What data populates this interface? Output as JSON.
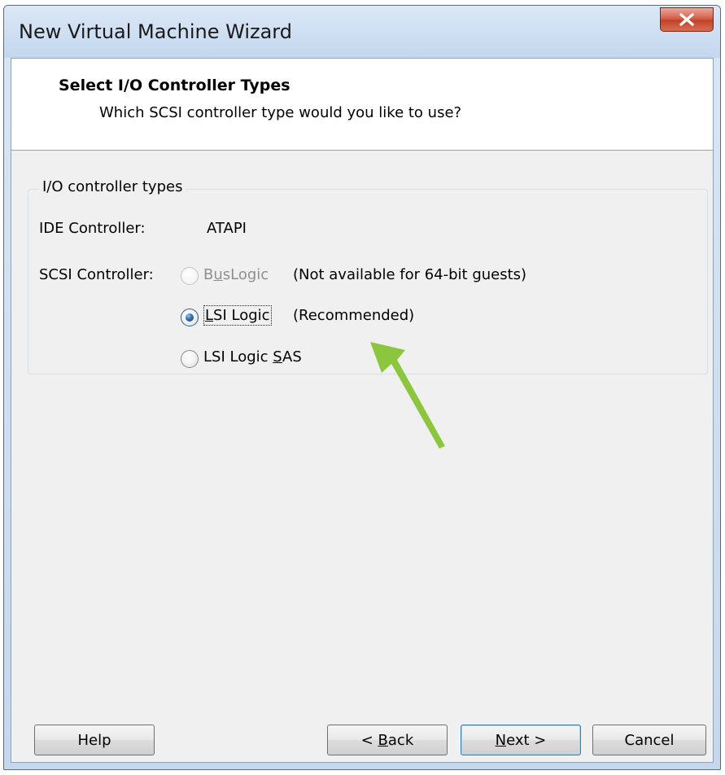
{
  "window": {
    "title": "New Virtual Machine Wizard"
  },
  "header": {
    "title": "Select I/O Controller Types",
    "subtitle": "Which SCSI controller type would you like to use?"
  },
  "group": {
    "legend": "I/O controller types",
    "ide_label": "IDE Controller:",
    "ide_value": "ATAPI",
    "scsi_label": "SCSI Controller:",
    "options": [
      {
        "label_pre": "B",
        "label_mnemonic": "u",
        "label_post": "sLogic",
        "note": "(Not available for 64-bit guests)",
        "selected": false,
        "enabled": false
      },
      {
        "label_pre": "",
        "label_mnemonic": "L",
        "label_post": "SI Logic",
        "note": "(Recommended)",
        "selected": true,
        "enabled": true
      },
      {
        "label_pre": "LSI Logic ",
        "label_mnemonic": "S",
        "label_post": "AS",
        "note": "",
        "selected": false,
        "enabled": true
      }
    ]
  },
  "buttons": {
    "help": "Help",
    "back_pre": "< ",
    "back_mnemonic": "B",
    "back_post": "ack",
    "next_mnemonic": "N",
    "next_post": "ext >",
    "cancel": "Cancel"
  },
  "annotation": {
    "arrow_color": "#8cc63f"
  }
}
